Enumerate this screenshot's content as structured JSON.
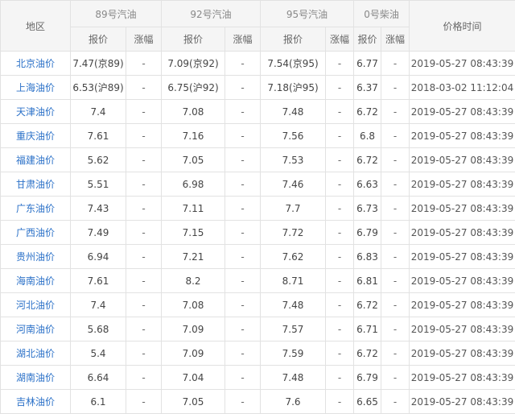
{
  "header": {
    "region": "地区",
    "fuels": [
      "89号汽油",
      "92号汽油",
      "95号汽油",
      "0号柴油"
    ],
    "price_label": "报价",
    "change_label": "涨幅",
    "time": "价格时间"
  },
  "rows": [
    {
      "region": "北京油价",
      "p89": "7.47(京89)",
      "c89": "-",
      "p92": "7.09(京92)",
      "c92": "-",
      "p95": "7.54(京95)",
      "c95": "-",
      "p0": "6.77",
      "c0": "-",
      "time": "2019-05-27 08:43:39"
    },
    {
      "region": "上海油价",
      "p89": "6.53(沪89)",
      "c89": "-",
      "p92": "6.75(沪92)",
      "c92": "-",
      "p95": "7.18(沪95)",
      "c95": "-",
      "p0": "6.37",
      "c0": "-",
      "time": "2018-03-02 11:12:04"
    },
    {
      "region": "天津油价",
      "p89": "7.4",
      "c89": "-",
      "p92": "7.08",
      "c92": "-",
      "p95": "7.48",
      "c95": "-",
      "p0": "6.72",
      "c0": "-",
      "time": "2019-05-27 08:43:39"
    },
    {
      "region": "重庆油价",
      "p89": "7.61",
      "c89": "-",
      "p92": "7.16",
      "c92": "-",
      "p95": "7.56",
      "c95": "-",
      "p0": "6.8",
      "c0": "-",
      "time": "2019-05-27 08:43:39"
    },
    {
      "region": "福建油价",
      "p89": "5.62",
      "c89": "-",
      "p92": "7.05",
      "c92": "-",
      "p95": "7.53",
      "c95": "-",
      "p0": "6.72",
      "c0": "-",
      "time": "2019-05-27 08:43:39"
    },
    {
      "region": "甘肃油价",
      "p89": "5.51",
      "c89": "-",
      "p92": "6.98",
      "c92": "-",
      "p95": "7.46",
      "c95": "-",
      "p0": "6.63",
      "c0": "-",
      "time": "2019-05-27 08:43:39"
    },
    {
      "region": "广东油价",
      "p89": "7.43",
      "c89": "-",
      "p92": "7.11",
      "c92": "-",
      "p95": "7.7",
      "c95": "-",
      "p0": "6.73",
      "c0": "-",
      "time": "2019-05-27 08:43:39"
    },
    {
      "region": "广西油价",
      "p89": "7.49",
      "c89": "-",
      "p92": "7.15",
      "c92": "-",
      "p95": "7.72",
      "c95": "-",
      "p0": "6.79",
      "c0": "-",
      "time": "2019-05-27 08:43:39"
    },
    {
      "region": "贵州油价",
      "p89": "6.94",
      "c89": "-",
      "p92": "7.21",
      "c92": "-",
      "p95": "7.62",
      "c95": "-",
      "p0": "6.83",
      "c0": "-",
      "time": "2019-05-27 08:43:39"
    },
    {
      "region": "海南油价",
      "p89": "7.61",
      "c89": "-",
      "p92": "8.2",
      "c92": "-",
      "p95": "8.71",
      "c95": "-",
      "p0": "6.81",
      "c0": "-",
      "time": "2019-05-27 08:43:39"
    },
    {
      "region": "河北油价",
      "p89": "7.4",
      "c89": "-",
      "p92": "7.08",
      "c92": "-",
      "p95": "7.48",
      "c95": "-",
      "p0": "6.72",
      "c0": "-",
      "time": "2019-05-27 08:43:39"
    },
    {
      "region": "河南油价",
      "p89": "5.68",
      "c89": "-",
      "p92": "7.09",
      "c92": "-",
      "p95": "7.57",
      "c95": "-",
      "p0": "6.71",
      "c0": "-",
      "time": "2019-05-27 08:43:39"
    },
    {
      "region": "湖北油价",
      "p89": "5.4",
      "c89": "-",
      "p92": "7.09",
      "c92": "-",
      "p95": "7.59",
      "c95": "-",
      "p0": "6.72",
      "c0": "-",
      "time": "2019-05-27 08:43:39"
    },
    {
      "region": "湖南油价",
      "p89": "6.64",
      "c89": "-",
      "p92": "7.04",
      "c92": "-",
      "p95": "7.48",
      "c95": "-",
      "p0": "6.79",
      "c0": "-",
      "time": "2019-05-27 08:43:39"
    },
    {
      "region": "吉林油价",
      "p89": "6.1",
      "c89": "-",
      "p92": "7.05",
      "c92": "-",
      "p95": "7.6",
      "c95": "-",
      "p0": "6.65",
      "c0": "-",
      "time": "2019-05-27 08:43:39"
    }
  ]
}
